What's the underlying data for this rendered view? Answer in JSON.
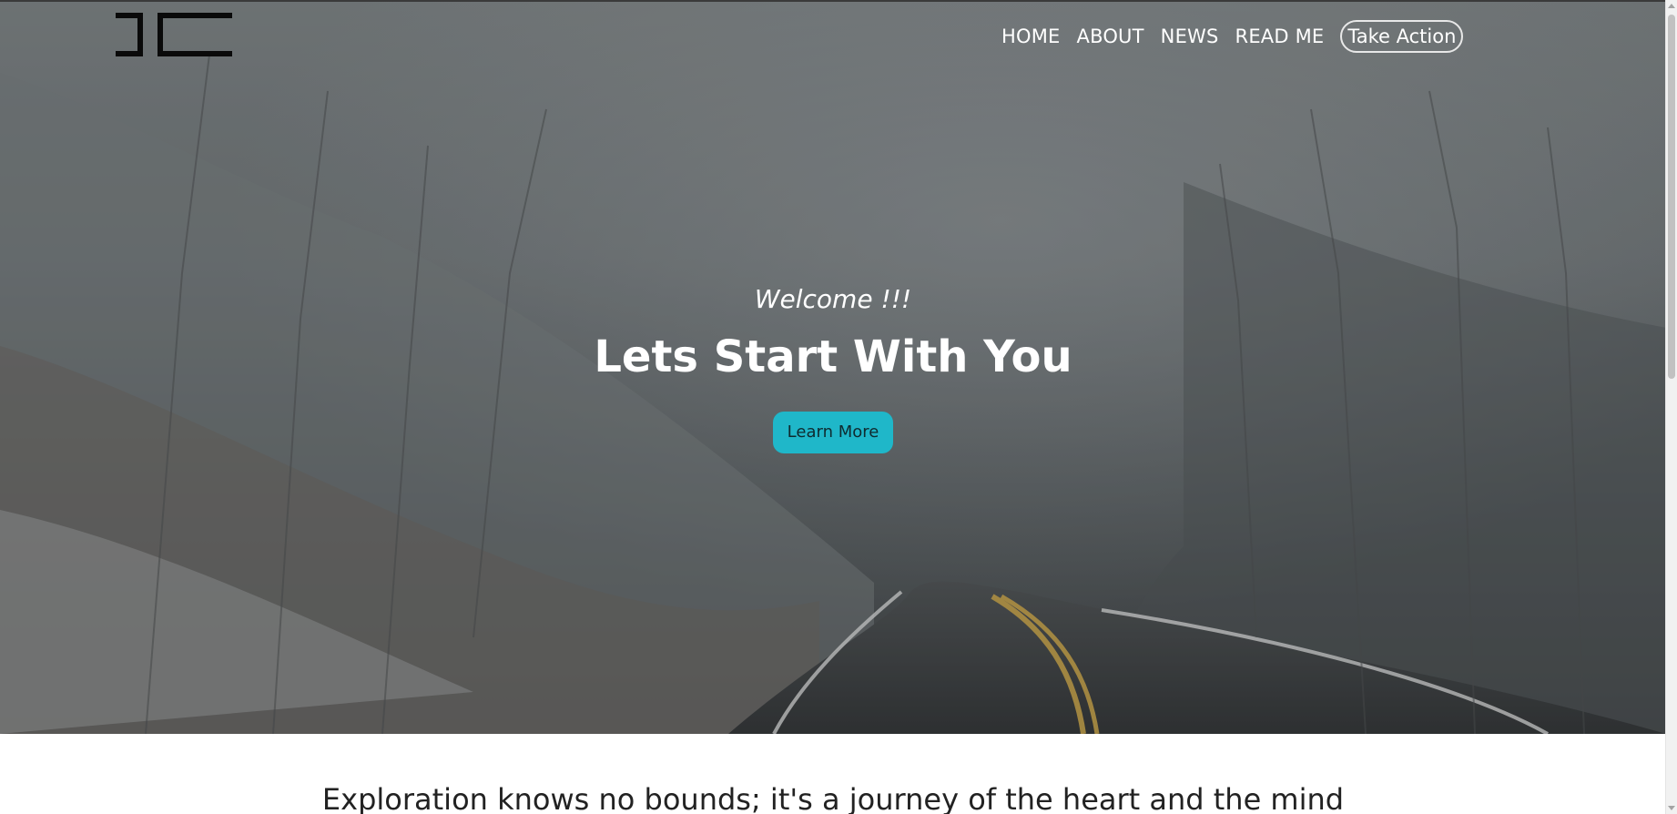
{
  "nav": {
    "items": [
      {
        "label": "HOME"
      },
      {
        "label": "ABOUT"
      },
      {
        "label": "NEWS"
      },
      {
        "label": "READ ME"
      }
    ],
    "cta_label": "Take Action"
  },
  "hero": {
    "welcome": "Welcome !!!",
    "headline": "Lets Start With You",
    "button_label": "Learn More"
  },
  "section": {
    "tagline": "Exploration knows no bounds; it's a journey of the heart and the mind"
  },
  "colors": {
    "accent": "#1fb7c9",
    "nav_text": "#ffffff",
    "tagline_text": "#222222"
  },
  "icons": {
    "logo": "jc-logo-icon"
  }
}
